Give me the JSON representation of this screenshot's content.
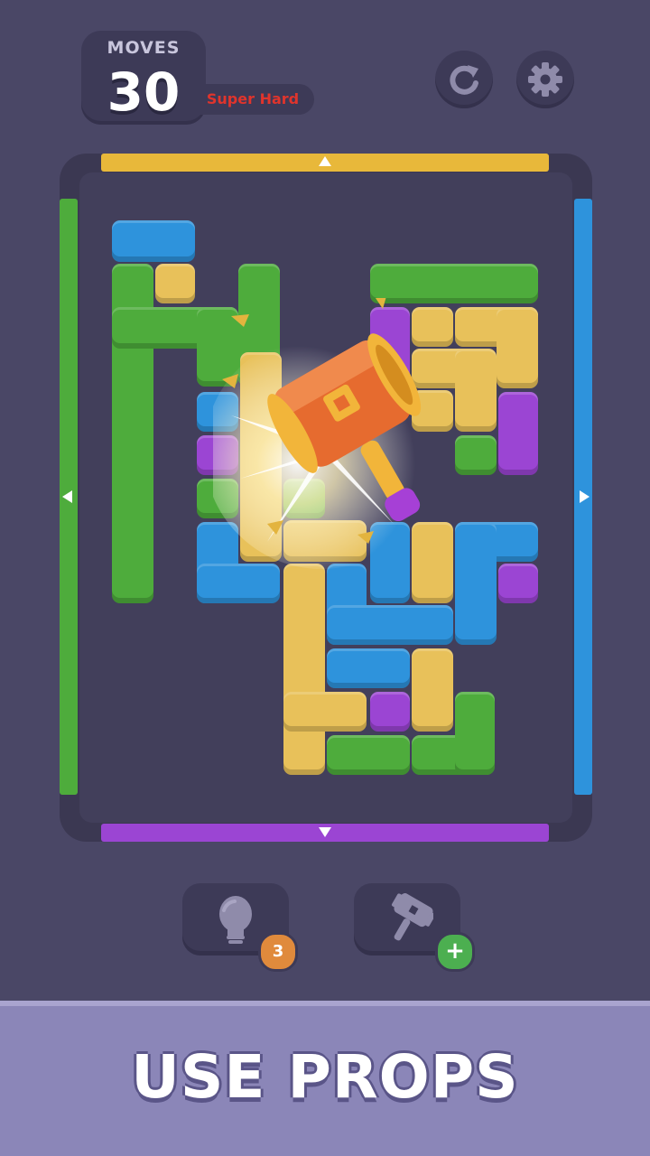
{
  "header": {
    "moves_label": "MOVES",
    "moves_value": "30",
    "difficulty": "Super Hard",
    "restart_icon": "restart-icon",
    "settings_icon": "gear-icon"
  },
  "board": {
    "exits": {
      "top": "#e8b83a",
      "bottom": "#9b45d3",
      "left": "#4eac3c",
      "right": "#2e93dc"
    }
  },
  "props": {
    "hint": {
      "icon": "lightbulb-icon",
      "count": "3",
      "badge_color": "#e08a3c"
    },
    "hammer": {
      "icon": "hammer-icon",
      "badge": "+",
      "badge_color": "#4caf50"
    }
  },
  "footer": {
    "caption": "USE PROPS"
  },
  "colors": {
    "background": "#4a4766",
    "blue": "#2e93dc",
    "green": "#4eac3c",
    "yellow": "#e8c15a",
    "purple": "#9b45d3"
  }
}
